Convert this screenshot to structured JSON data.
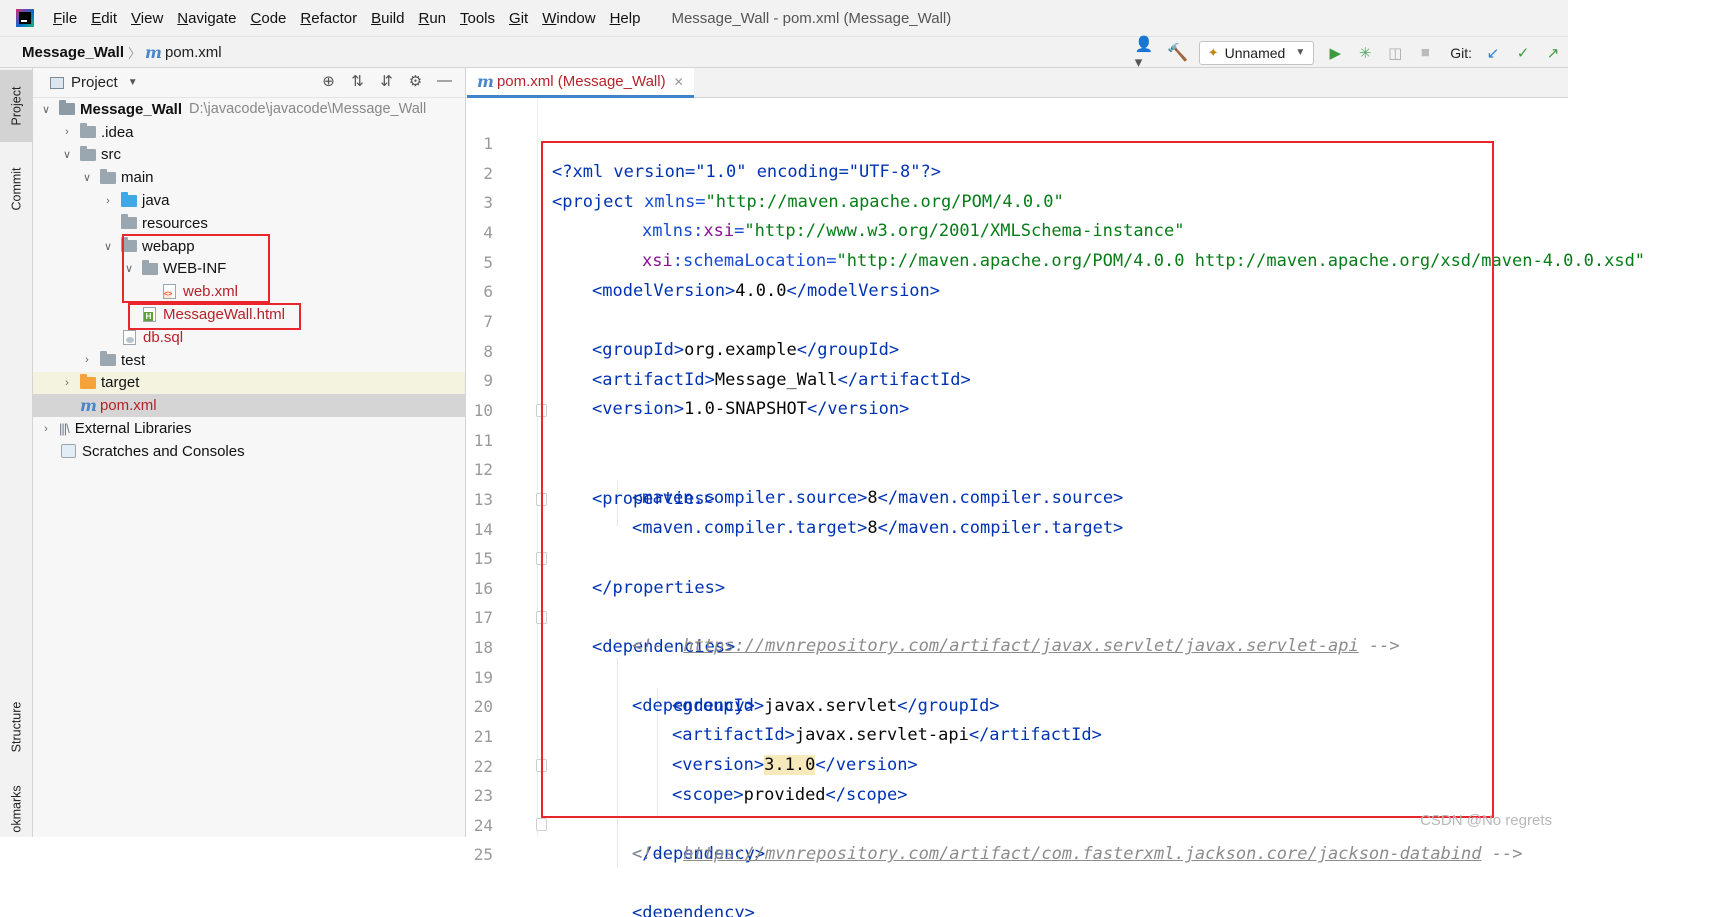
{
  "menubar": {
    "items": [
      "File",
      "Edit",
      "View",
      "Navigate",
      "Code",
      "Refactor",
      "Build",
      "Run",
      "Tools",
      "Git",
      "Window",
      "Help"
    ],
    "window_title": "Message_Wall - pom.xml (Message_Wall)"
  },
  "navbar": {
    "project": "Message_Wall",
    "file": "pom.xml",
    "run_config": "Unnamed",
    "git_label": "Git:"
  },
  "left_strip": {
    "project_tab": "Project",
    "commit_tab": "Commit",
    "structure_tab": "Structure",
    "bookmarks_tab": "okmarks"
  },
  "project_panel": {
    "title": "Project",
    "tree": {
      "root_name": "Message_Wall",
      "root_path": "D:\\javacode\\javacode\\Message_Wall",
      "idea": ".idea",
      "src": "src",
      "main": "main",
      "java": "java",
      "resources": "resources",
      "webapp": "webapp",
      "web_inf": "WEB-INF",
      "web_xml": "web.xml",
      "message_wall_html": "MessageWall.html",
      "db_sql": "db.sql",
      "test": "test",
      "target": "target",
      "pom_xml": "pom.xml",
      "external_libraries": "External Libraries",
      "scratches": "Scratches and Consoles"
    }
  },
  "editor": {
    "tab_label": "pom.xml (Message_Wall)",
    "line_numbers": [
      "1",
      "2",
      "3",
      "4",
      "5",
      "6",
      "7",
      "8",
      "9",
      "10",
      "11",
      "12",
      "13",
      "14",
      "15",
      "16",
      "17",
      "18",
      "19",
      "20",
      "21",
      "22",
      "23",
      "24",
      "25"
    ],
    "code": {
      "l1": [
        "<?xml version=\"1.0\" encoding=\"UTF-8\"?>"
      ],
      "l2": [
        "<project",
        " xmlns=",
        "\"http://maven.apache.org/POM/4.0.0\""
      ],
      "l3": [
        "xmlns:",
        "xsi",
        "=",
        "\"http://www.w3.org/2001/XMLSchema-instance\""
      ],
      "l4": [
        "xsi",
        ":schemaLocation=",
        "\"http://maven.apache.org/POM/4.0.0 http://maven.apache.org/xsd/maven-4.0.0.xsd\""
      ],
      "l5": [
        "<modelVersion>",
        "4.0.0",
        "</modelVersion>"
      ],
      "l7": [
        "<groupId>",
        "org.example",
        "</groupId>"
      ],
      "l8": [
        "<artifactId>",
        "Message_Wall",
        "</artifactId>"
      ],
      "l9": [
        "<version>",
        "1.0-SNAPSHOT",
        "</version>"
      ],
      "l11": [
        "<properties>"
      ],
      "l12": [
        "<maven.compiler.source>",
        "8",
        "</maven.compiler.source>"
      ],
      "l13": [
        "<maven.compiler.target>",
        "8",
        "</maven.compiler.target>"
      ],
      "l14": [
        "</properties>"
      ],
      "l16": [
        "<dependencies>"
      ],
      "l17": [
        "<!-- ",
        "https://mvnrepository.com/artifact/javax.servlet/javax.servlet-api",
        " -->"
      ],
      "l18": [
        "<dependency>"
      ],
      "l19": [
        "<groupId>",
        "javax.servlet",
        "</groupId>"
      ],
      "l20": [
        "<artifactId>",
        "javax.servlet-api",
        "</artifactId>"
      ],
      "l21": [
        "<version>",
        "3.1.0",
        "</version>"
      ],
      "l22": [
        "<scope>",
        "provided",
        "</scope>"
      ],
      "l23": [
        "</dependency>"
      ],
      "l24": [
        "<!-- ",
        "https://mvnrepository.com/artifact/com.fasterxml.jackson.core/jackson-databind",
        " -->"
      ],
      "l25": [
        "<dependency>"
      ]
    }
  },
  "watermark": "CSDN @No regrets",
  "colors": {
    "annotation_box": "#e8262c",
    "xml_tag": "#0033b3",
    "xml_value": "#067d17",
    "namespace": "#871094",
    "comment": "#8c8c8c"
  }
}
